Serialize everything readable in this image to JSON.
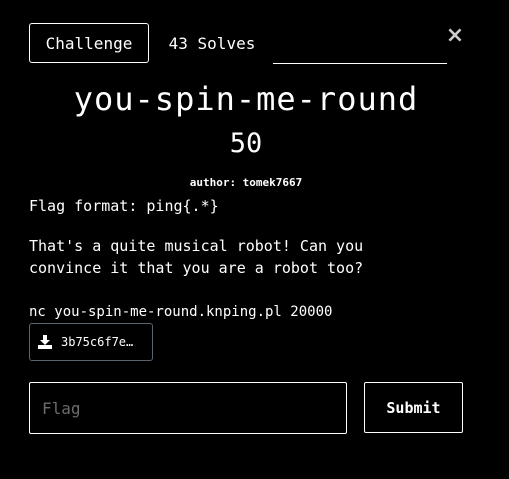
{
  "tabs": {
    "challenge_label": "Challenge",
    "solves_label": "43 Solves"
  },
  "close": {
    "glyph": "×"
  },
  "challenge": {
    "title": "you-spin-me-round",
    "points": "50",
    "author": "author: tomek7667",
    "flag_format": "Flag format: ping{.*}",
    "description": "That's a quite musical robot! Can you\nconvince it that you are a robot too?",
    "connection": "nc you-spin-me-round.knping.pl 20000"
  },
  "file": {
    "label": "3b75c6f7e…",
    "icon": "download-icon"
  },
  "flag_form": {
    "placeholder": "Flag",
    "value": "",
    "submit_label": "Submit"
  },
  "colors": {
    "background": "#000000",
    "text": "#ffffff",
    "file_border": "#5b6470",
    "placeholder": "#6c6c6c"
  }
}
